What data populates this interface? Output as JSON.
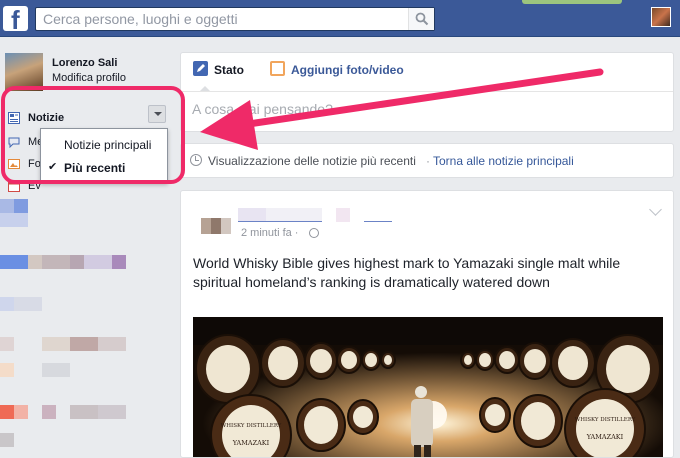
{
  "topbar": {
    "logo": "f",
    "search_placeholder": "Cerca persone, luoghi e oggetti",
    "search_icon": "search-icon"
  },
  "profile": {
    "name": "Lorenzo Sali",
    "edit_label": "Modifica profilo"
  },
  "sidebar": {
    "news_label": "Notizie",
    "partial_items": [
      "Me",
      "Fo",
      "Ev"
    ]
  },
  "news_dropdown": {
    "items": [
      {
        "label": "Notizie principali",
        "checked": false
      },
      {
        "label": "Più recenti",
        "checked": true
      }
    ]
  },
  "composer": {
    "tab_status": "Stato",
    "tab_photo": "Aggiungi foto/video",
    "placeholder": "A cosa stai pensando?"
  },
  "feed_info": {
    "text": "Visualizzazione delle notizie più recenti",
    "separator": "·",
    "link": "Torna alle notizie principali"
  },
  "post": {
    "time": "2 minuti fa ·",
    "text": "World Whisky Bible gives highest mark to Yamazaki single malt while spiritual homeland’s ranking is dramatically watered down",
    "barrel_labels": [
      "WHISKY DISTILLERY",
      "YAMAZAKI"
    ]
  },
  "colors": {
    "brand": "#3b5998",
    "annotation": "#ef2a68"
  }
}
